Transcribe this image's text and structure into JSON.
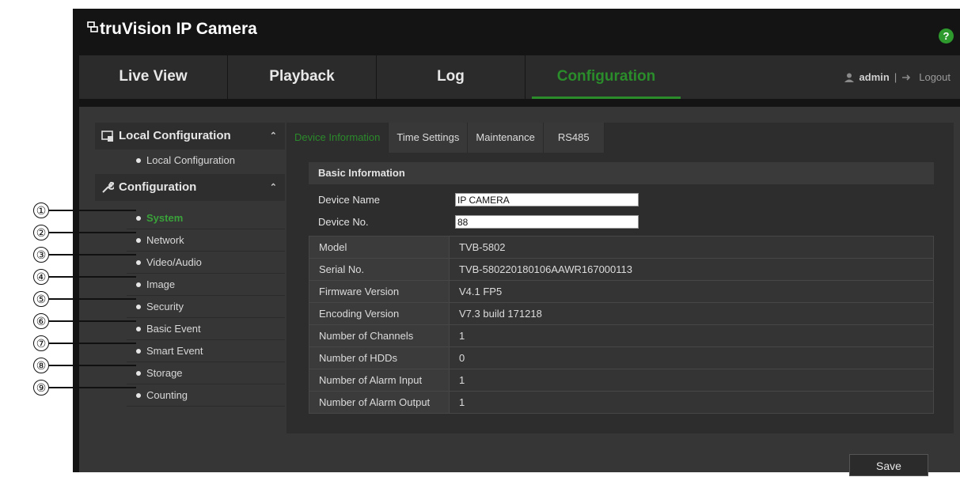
{
  "app": {
    "brand": "truVision IP Camera",
    "help_glyph": "?"
  },
  "nav": {
    "tabs": [
      {
        "label": "Live View"
      },
      {
        "label": "Playback"
      },
      {
        "label": "Log"
      },
      {
        "label": "Configuration",
        "active": true
      }
    ],
    "user": "admin",
    "logout": "Logout"
  },
  "sidebar": {
    "local": {
      "title": "Local Configuration",
      "items": [
        "Local Configuration"
      ]
    },
    "config": {
      "title": "Configuration",
      "items": [
        "System",
        "Network",
        "Video/Audio",
        "Image",
        "Security",
        "Basic Event",
        "Smart Event",
        "Storage",
        "Counting"
      ],
      "active": "System"
    }
  },
  "content": {
    "tabs": [
      "Device Information",
      "Time Settings",
      "Maintenance",
      "RS485"
    ],
    "active_tab": "Device Information",
    "section": "Basic Information",
    "fields": {
      "device_name_label": "Device Name",
      "device_name_value": "IP CAMERA",
      "device_no_label": "Device No.",
      "device_no_value": "88"
    },
    "info": [
      {
        "k": "Model",
        "v": "TVB-5802"
      },
      {
        "k": "Serial No.",
        "v": "TVB-580220180106AAWR167000113"
      },
      {
        "k": "Firmware Version",
        "v": "V4.1 FP5"
      },
      {
        "k": "Encoding Version",
        "v": "V7.3 build 171218"
      },
      {
        "k": "Number of Channels",
        "v": "1"
      },
      {
        "k": "Number of HDDs",
        "v": "0"
      },
      {
        "k": "Number of Alarm Input",
        "v": "1"
      },
      {
        "k": "Number of Alarm Output",
        "v": "1"
      }
    ],
    "save_label": "Save"
  },
  "callouts": [
    "①",
    "②",
    "③",
    "④",
    "⑤",
    "⑥",
    "⑦",
    "⑧",
    "⑨"
  ],
  "colors": {
    "accent": "#2a8c2a",
    "background": "#141414",
    "panel": "#363636"
  }
}
